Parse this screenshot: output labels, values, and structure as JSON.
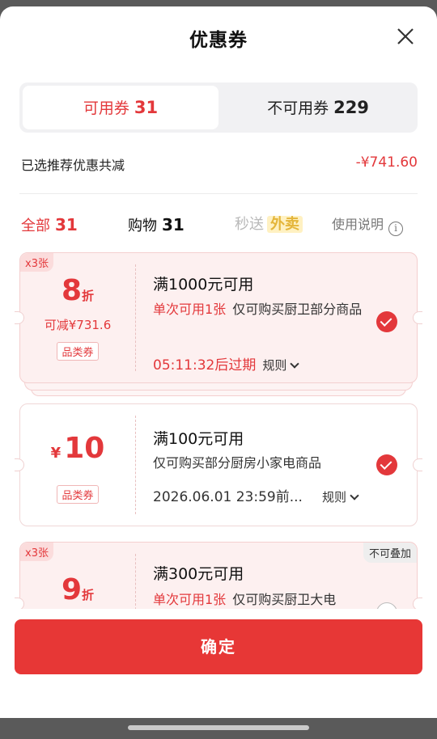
{
  "sheet": {
    "title": "优惠券"
  },
  "tabs": [
    {
      "label": "可用券",
      "count": "31"
    },
    {
      "label": "不可用券",
      "count": "229"
    }
  ],
  "summary": {
    "label": "已选推荐优惠共减",
    "amount": "-¥741.60"
  },
  "filters": {
    "all": {
      "label": "全部",
      "count": "31"
    },
    "shopping": {
      "label": "购物",
      "count": "31"
    },
    "flash": {
      "label": "秒送",
      "tag": "外卖"
    },
    "help": "使用说明"
  },
  "coupons": [
    {
      "badge": "x3张",
      "value": "8",
      "unit": "折",
      "reduce": "可减¥731.6",
      "category": "品类券",
      "condition": "满1000元可用",
      "limit": "单次可用1张",
      "scope": "仅可购买厨卫部分商品",
      "expiry": "05:11:32后过期",
      "rule": "规则",
      "selected": true
    },
    {
      "currency": "¥",
      "value": "10",
      "category": "品类券",
      "condition": "满100元可用",
      "scope": "仅可购买部分厨房小家电商品",
      "expiry": "2026.06.01 23:59前...",
      "rule": "规则",
      "selected": true
    },
    {
      "badge": "x3张",
      "value": "9",
      "unit": "折",
      "condition": "满300元可用",
      "limit": "单次可用1张",
      "scope": "仅可购买厨卫大电",
      "tag": "不可叠加",
      "selected": false
    }
  ],
  "footer": {
    "confirm": "确定"
  },
  "colors": {
    "accent": "#e3383b",
    "button": "#e73736"
  }
}
